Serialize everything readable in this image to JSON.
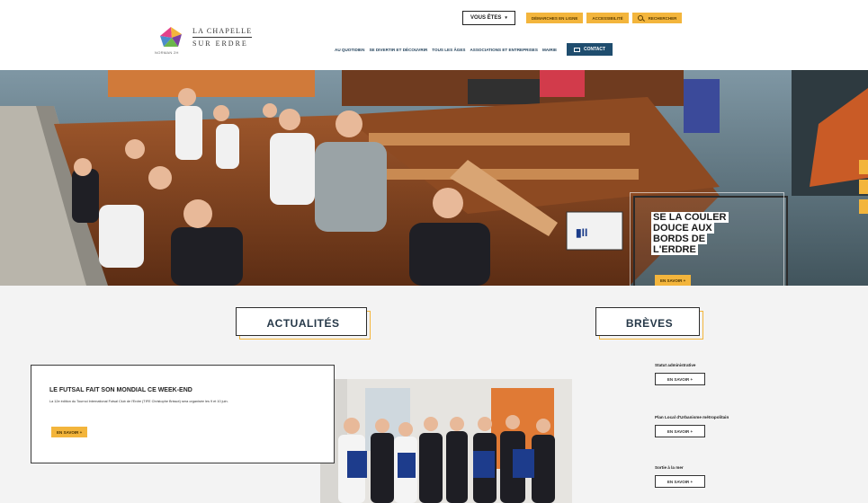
{
  "header": {
    "logo": {
      "line1": "LA CHAPELLE",
      "line2": "SUR ERDRE",
      "sub": "NORMAN 2H"
    },
    "topbar": {
      "vous_etes": "VOUS ÊTES",
      "demarches": "DÉMARCHES EN LIGNE",
      "accessibilite": "ACCESSIBILITÉ",
      "rechercher": "RECHERCHER"
    },
    "nav": [
      "AU QUOTIDIEN",
      "SE DIVERTIR ET DÉCOUVRIR",
      "TOUS LES ÂGES",
      "ASSOCIATIONS ET ENTREPRISES",
      "MAIRIE"
    ],
    "contact": "CONTACT"
  },
  "hero": {
    "title_lines": [
      "SE LA COULER",
      "DOUCE AUX",
      "BORDS DE",
      "L'ERDRE"
    ],
    "button": "EN SAVOIR +"
  },
  "actualites": {
    "heading": "ACTUALITÉS",
    "card": {
      "title": "LE FUTSAL FAIT SON MONDIAL CE WEEK-END",
      "desc": "La 12e édition du Tournoi International Futsal Club de l'Erdre (TIFE Christophe Brissot) sera organisée les 9 et 10 juin.",
      "button": "EN SAVOIR +"
    }
  },
  "breves": {
    "heading": "BRÈVES",
    "items": [
      {
        "title": "Statut administrative",
        "button": "EN SAVOIR +"
      },
      {
        "title": "Plan Local d'Urbanisme métropolitain",
        "button": "EN SAVOIR +"
      },
      {
        "title": "Sortie à la mer",
        "button": "EN SAVOIR +"
      }
    ]
  },
  "colors": {
    "accent_yellow": "#f3b53c",
    "nav_blue": "#27455e",
    "contact_blue": "#1f4d6e"
  }
}
